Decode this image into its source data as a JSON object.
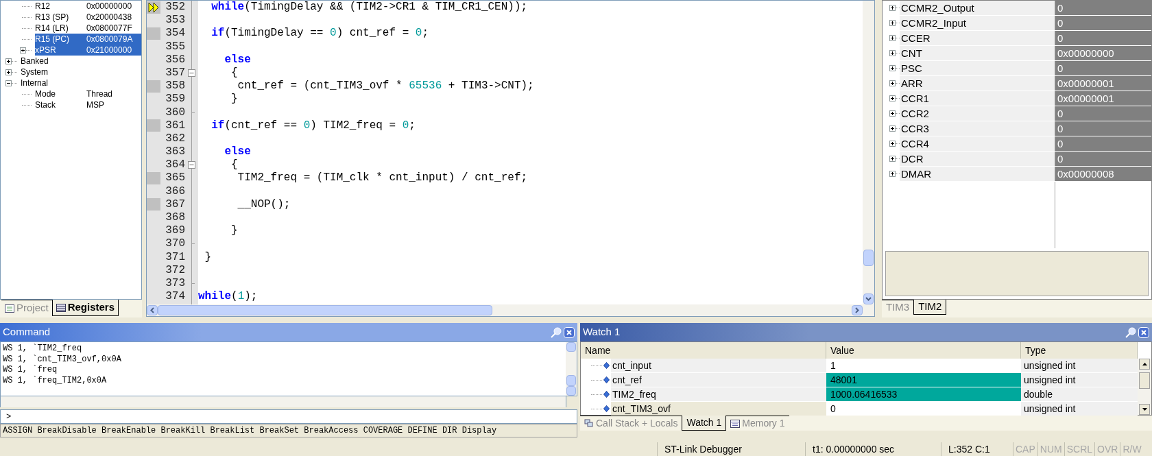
{
  "registers_panel": {
    "tree": [
      {
        "children": [
          {
            "name": "R12",
            "value": "0x00000000",
            "selected": false
          },
          {
            "name": "R13 (SP)",
            "value": "0x20000438",
            "selected": false
          },
          {
            "name": "R14 (LR)",
            "value": "0x0800077F",
            "selected": false
          },
          {
            "name": "R15 (PC)",
            "value": "0x0800079A",
            "selected": true
          },
          {
            "name": "xPSR",
            "value": "0x21000000",
            "selected": true,
            "expanded": false
          }
        ]
      },
      {
        "name": "Banked",
        "selected": false,
        "expanded": false
      },
      {
        "name": "System",
        "selected": false,
        "expanded": false
      },
      {
        "name": "Internal",
        "selected": false,
        "expanded": true,
        "children": [
          {
            "name": "Mode",
            "value": "Thread",
            "selected": false
          },
          {
            "name": "Stack",
            "value": "MSP",
            "selected": false
          }
        ]
      }
    ],
    "tabs": [
      {
        "label": "Project",
        "selected": false
      },
      {
        "label": "Registers",
        "selected": true
      }
    ]
  },
  "editor": {
    "lines": [
      {
        "number": "352",
        "current": true,
        "executable": true,
        "fold_start": false,
        "fold_end": false,
        "tokens": [
          {
            "kind": "kw",
            "text": "  while"
          },
          {
            "kind": "text",
            "text": "(TimingDelay && (TIM2->CR1 & TIM_CR1_CEN));"
          }
        ]
      },
      {
        "number": "353",
        "current": false,
        "executable": false,
        "fold_start": false,
        "fold_end": false
      },
      {
        "number": "354",
        "current": false,
        "executable": true,
        "fold_start": false,
        "fold_end": false,
        "tokens": [
          {
            "kind": "kw",
            "text": "  if"
          },
          {
            "kind": "text",
            "text": "(TimingDelay == "
          },
          {
            "kind": "num",
            "text": "0"
          },
          {
            "kind": "text",
            "text": ") cnt_ref = "
          },
          {
            "kind": "num",
            "text": "0"
          },
          {
            "kind": "text",
            "text": ";"
          }
        ]
      },
      {
        "number": "355",
        "current": false,
        "executable": false,
        "fold_start": false,
        "fold_end": false
      },
      {
        "number": "356",
        "current": false,
        "executable": false,
        "fold_start": false,
        "fold_end": false,
        "tokens": [
          {
            "kind": "kw",
            "text": "    else"
          }
        ]
      },
      {
        "number": "357",
        "current": false,
        "executable": false,
        "fold_start": true,
        "fold_end": false,
        "tokens": [
          {
            "kind": "text",
            "text": "     {"
          }
        ]
      },
      {
        "number": "358",
        "current": false,
        "executable": true,
        "fold_start": false,
        "fold_end": false,
        "tokens": [
          {
            "kind": "text",
            "text": "      cnt_ref = (cnt_TIM3_ovf * "
          },
          {
            "kind": "num",
            "text": "65536"
          },
          {
            "kind": "text",
            "text": " + TIM3->CNT);"
          }
        ]
      },
      {
        "number": "359",
        "current": false,
        "executable": false,
        "fold_start": false,
        "fold_end": false,
        "tokens": [
          {
            "kind": "text",
            "text": "     }"
          }
        ]
      },
      {
        "number": "360",
        "current": false,
        "executable": false,
        "fold_start": false,
        "fold_end": true
      },
      {
        "number": "361",
        "current": false,
        "executable": true,
        "fold_start": false,
        "fold_end": false,
        "tokens": [
          {
            "kind": "kw",
            "text": "  if"
          },
          {
            "kind": "text",
            "text": "(cnt_ref == "
          },
          {
            "kind": "num",
            "text": "0"
          },
          {
            "kind": "text",
            "text": ") TIM2_freq = "
          },
          {
            "kind": "num",
            "text": "0"
          },
          {
            "kind": "text",
            "text": ";"
          }
        ]
      },
      {
        "number": "362",
        "current": false,
        "executable": false,
        "fold_start": false,
        "fold_end": false
      },
      {
        "number": "363",
        "current": false,
        "executable": false,
        "fold_start": false,
        "fold_end": false,
        "tokens": [
          {
            "kind": "kw",
            "text": "    else"
          }
        ]
      },
      {
        "number": "364",
        "current": false,
        "executable": false,
        "fold_start": true,
        "fold_end": false,
        "tokens": [
          {
            "kind": "text",
            "text": "     {"
          }
        ]
      },
      {
        "number": "365",
        "current": false,
        "executable": true,
        "fold_start": false,
        "fold_end": false,
        "tokens": [
          {
            "kind": "text",
            "text": "      TIM2_freq = (TIM_clk * cnt_input) / cnt_ref;"
          }
        ]
      },
      {
        "number": "366",
        "current": false,
        "executable": false,
        "fold_start": false,
        "fold_end": false
      },
      {
        "number": "367",
        "current": false,
        "executable": true,
        "fold_start": false,
        "fold_end": false,
        "tokens": [
          {
            "kind": "text",
            "text": "      __NOP();"
          }
        ]
      },
      {
        "number": "368",
        "current": false,
        "executable": false,
        "fold_start": false,
        "fold_end": false
      },
      {
        "number": "369",
        "current": false,
        "executable": false,
        "fold_start": false,
        "fold_end": false,
        "tokens": [
          {
            "kind": "text",
            "text": "     }"
          }
        ]
      },
      {
        "number": "370",
        "current": false,
        "executable": false,
        "fold_start": false,
        "fold_end": true
      },
      {
        "number": "371",
        "current": false,
        "executable": false,
        "fold_start": false,
        "fold_end": false,
        "tokens": [
          {
            "kind": "text",
            "text": " }"
          }
        ]
      },
      {
        "number": "372",
        "current": false,
        "executable": false,
        "fold_start": false,
        "fold_end": false
      },
      {
        "number": "373",
        "current": false,
        "executable": false,
        "fold_start": false,
        "fold_end": true
      },
      {
        "number": "374",
        "current": false,
        "executable": false,
        "fold_start": false,
        "fold_end": false,
        "tokens": [
          {
            "kind": "kw",
            "text": "while"
          },
          {
            "kind": "text",
            "text": "("
          },
          {
            "kind": "num",
            "text": "1"
          },
          {
            "kind": "text",
            "text": ");"
          }
        ]
      }
    ]
  },
  "peripheral_panel": {
    "rows": [
      {
        "name": "CCMR2_Output",
        "value": "0"
      },
      {
        "name": "CCMR2_Input",
        "value": "0"
      },
      {
        "name": "CCER",
        "value": "0"
      },
      {
        "name": "CNT",
        "value": "0x00000000"
      },
      {
        "name": "PSC",
        "value": "0"
      },
      {
        "name": "ARR",
        "value": "0x00000001"
      },
      {
        "name": "CCR1",
        "value": "0x00000001"
      },
      {
        "name": "CCR2",
        "value": "0"
      },
      {
        "name": "CCR3",
        "value": "0"
      },
      {
        "name": "CCR4",
        "value": "0"
      },
      {
        "name": "DCR",
        "value": "0"
      },
      {
        "name": "DMAR",
        "value": "0x00000008"
      }
    ],
    "tabs": [
      {
        "label": "TIM3",
        "selected": false
      },
      {
        "label": "TIM2",
        "selected": true
      }
    ]
  },
  "command_window": {
    "title": "Command",
    "output": [
      "WS 1, `TIM2_freq",
      "WS 1, `cnt_TIM3_ovf,0x0A",
      "WS 1, `freq",
      "WS 1, `freq_TIM2,0x0A"
    ],
    "prompt": ">",
    "hint": "ASSIGN BreakDisable BreakEnable BreakKill BreakList BreakSet BreakAccess COVERAGE DEFINE DIR Display"
  },
  "watch_window": {
    "title": "Watch 1",
    "columns": [
      "Name",
      "Value",
      "Type"
    ],
    "rows": [
      {
        "name": "cnt_input",
        "value": "1",
        "type": "unsigned int",
        "changed": false,
        "selected": false
      },
      {
        "name": "cnt_ref",
        "value": "48001",
        "type": "unsigned int",
        "changed": true,
        "selected": false
      },
      {
        "name": "TIM2_freq",
        "value": "1000.06416533",
        "type": "double",
        "changed": true,
        "selected": false
      },
      {
        "name": "cnt_TIM3_ovf",
        "value": "0",
        "type": "unsigned int",
        "changed": false,
        "selected": true
      }
    ],
    "tabs": [
      {
        "label": "Call Stack + Locals",
        "selected": false,
        "kind": "stack"
      },
      {
        "label": "Watch 1",
        "selected": true,
        "kind": "watch"
      },
      {
        "label": "Memory 1",
        "selected": false,
        "kind": "memory"
      }
    ]
  },
  "status_bar": {
    "target": "ST-Link Debugger",
    "time": "t1: 0.00000000 sec",
    "position": "L:352 C:1",
    "indicators": [
      {
        "label": "CAP",
        "on": false
      },
      {
        "label": "NUM",
        "on": false
      },
      {
        "label": "SCRL",
        "on": false
      },
      {
        "label": "OVR",
        "on": false
      },
      {
        "label": "R/W",
        "on": false
      }
    ]
  }
}
